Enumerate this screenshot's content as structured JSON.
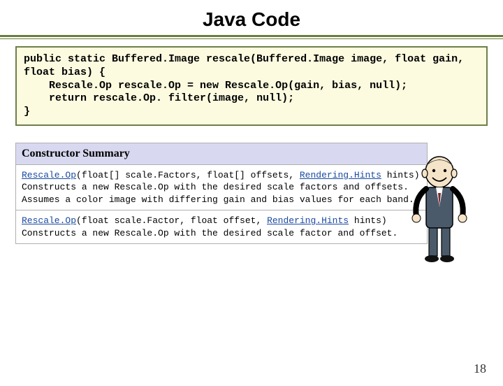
{
  "title": "Java Code",
  "code": "public static Buffered.Image rescale(Buffered.Image image, float gain, float bias) {\n    Rescale.Op rescale.Op = new Rescale.Op(gain, bias, null);\n    return rescale.Op. filter(image, null);\n}",
  "summary": {
    "header": "Constructor Summary",
    "rows": [
      {
        "link1": "Rescale.Op",
        "sig1": "(float[] scale.Factors, float[] offsets, ",
        "link2": "Rendering.Hints",
        "sig2": " hints)",
        "desc": "Constructs a new Rescale.Op with the desired scale factors and offsets. Assumes a color image with differing gain and bias values for each band."
      },
      {
        "link1": "Rescale.Op",
        "sig1": "(float scale.Factor, float offset, ",
        "link2": "Rendering.Hints",
        "sig2": " hints)",
        "desc": "Constructs a new Rescale.Op with the desired scale factor and offset."
      }
    ]
  },
  "page_number": "18"
}
